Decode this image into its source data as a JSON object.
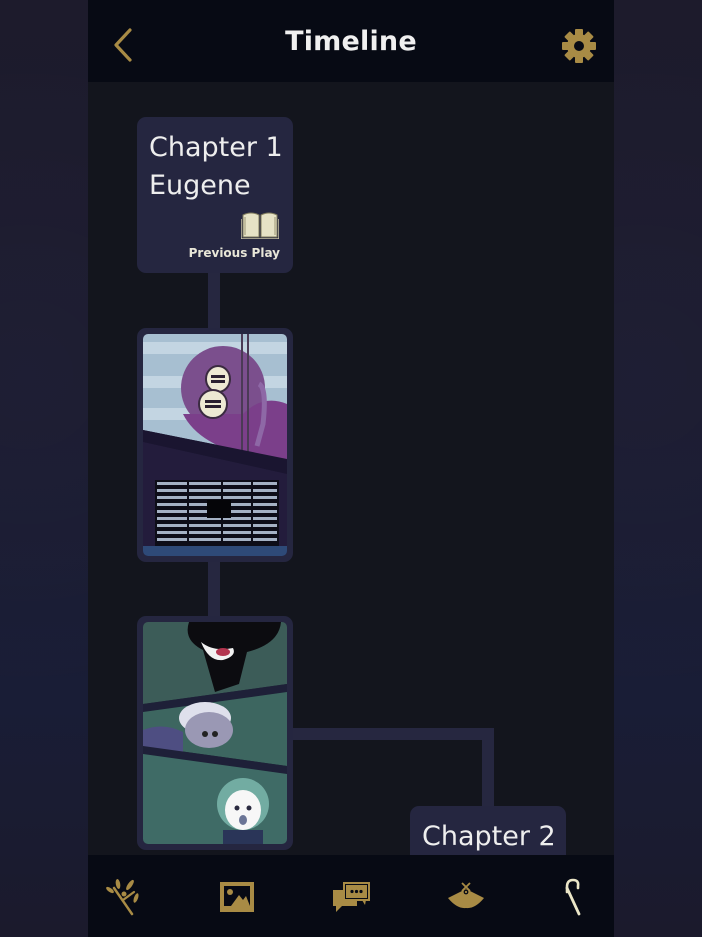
{
  "header": {
    "title": "Timeline",
    "back_icon": "chevron-left-icon",
    "settings_icon": "gear-icon"
  },
  "colors": {
    "accent_gold": "#a88b45",
    "active_cream": "#ebe6c8",
    "node_bg": "#252640",
    "panel_bg": "#13151d",
    "bar_bg": "#070a14"
  },
  "timeline": {
    "chapters": [
      {
        "line1": "Chapter 1",
        "line2": "Eugene",
        "icon": "open-book-icon",
        "action_label": "Previous Play"
      },
      {
        "line1": "Chapter 2"
      }
    ],
    "scenes": [
      {
        "description": "Purple-haired character with goggles peering through window above a shuttered building"
      },
      {
        "description": "Three-panel scene: shadowy figure, elderly woman with glasses, smiling child"
      }
    ]
  },
  "bottom_nav": {
    "tabs": [
      {
        "name": "branch",
        "icon": "twig-icon",
        "active": false
      },
      {
        "name": "gallery",
        "icon": "picture-icon",
        "active": false
      },
      {
        "name": "messages",
        "icon": "chat-bubbles-icon",
        "active": false
      },
      {
        "name": "fan",
        "icon": "folding-fan-icon",
        "active": false
      },
      {
        "name": "cane",
        "icon": "cane-icon",
        "active": true
      }
    ]
  }
}
